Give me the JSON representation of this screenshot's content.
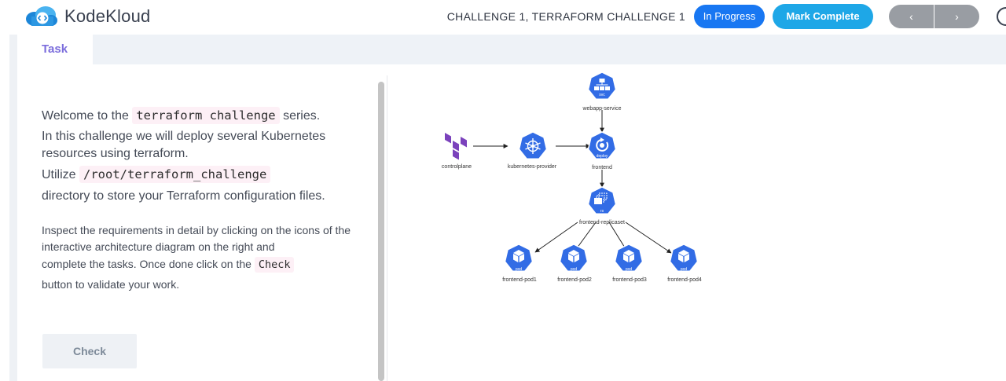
{
  "header": {
    "brand": "KodeKloud",
    "challenge_title": "CHALLENGE 1, TERRAFORM CHALLENGE 1",
    "status_button": "In Progress",
    "complete_button": "Mark Complete",
    "prev_glyph": "‹",
    "next_glyph": "›"
  },
  "tabs": {
    "task": "Task"
  },
  "task": {
    "p1_pre": "Welcome to the ",
    "p1_code": "terraform challenge",
    "p1_post": " series.",
    "p2": "In this challenge we will deploy several Kubernetes resources using terraform.",
    "p3_pre": "Utilize ",
    "p3_code": "/root/terraform_challenge",
    "p4": "directory to store your Terraform configuration files.",
    "p5": "Inspect the requirements in detail by clicking on the icons of the interactive architecture diagram on the right and",
    "p6_pre": "complete the tasks. Once done click on the ",
    "p6_code": "Check",
    "p7": "button to validate your work.",
    "check_button": "Check"
  },
  "diagram": {
    "nodes": {
      "controlplane": "controlplane",
      "kubernetes_provider": "kubernetes-provider",
      "frontend": "frontend",
      "webapp_service": "webapp-service",
      "frontend_replicaset": "frontend-replicaset",
      "pod1": "frontend-pod1",
      "pod2": "frontend-pod2",
      "pod3": "frontend-pod3",
      "pod4": "frontend-pod4"
    },
    "icon_tags": {
      "svc": "svc",
      "deploy": "deploy",
      "rs": "rs",
      "pod": "pod"
    },
    "colors": {
      "k8s_blue": "#326ce5",
      "terraform_purple": "#7b42bc"
    }
  },
  "colors": {
    "in_progress": "#1877f2",
    "mark_complete": "#1ea7e7",
    "nav": "#999da3",
    "task_tab": "#7b6ddc",
    "code_bg": "#fdf0f6"
  }
}
